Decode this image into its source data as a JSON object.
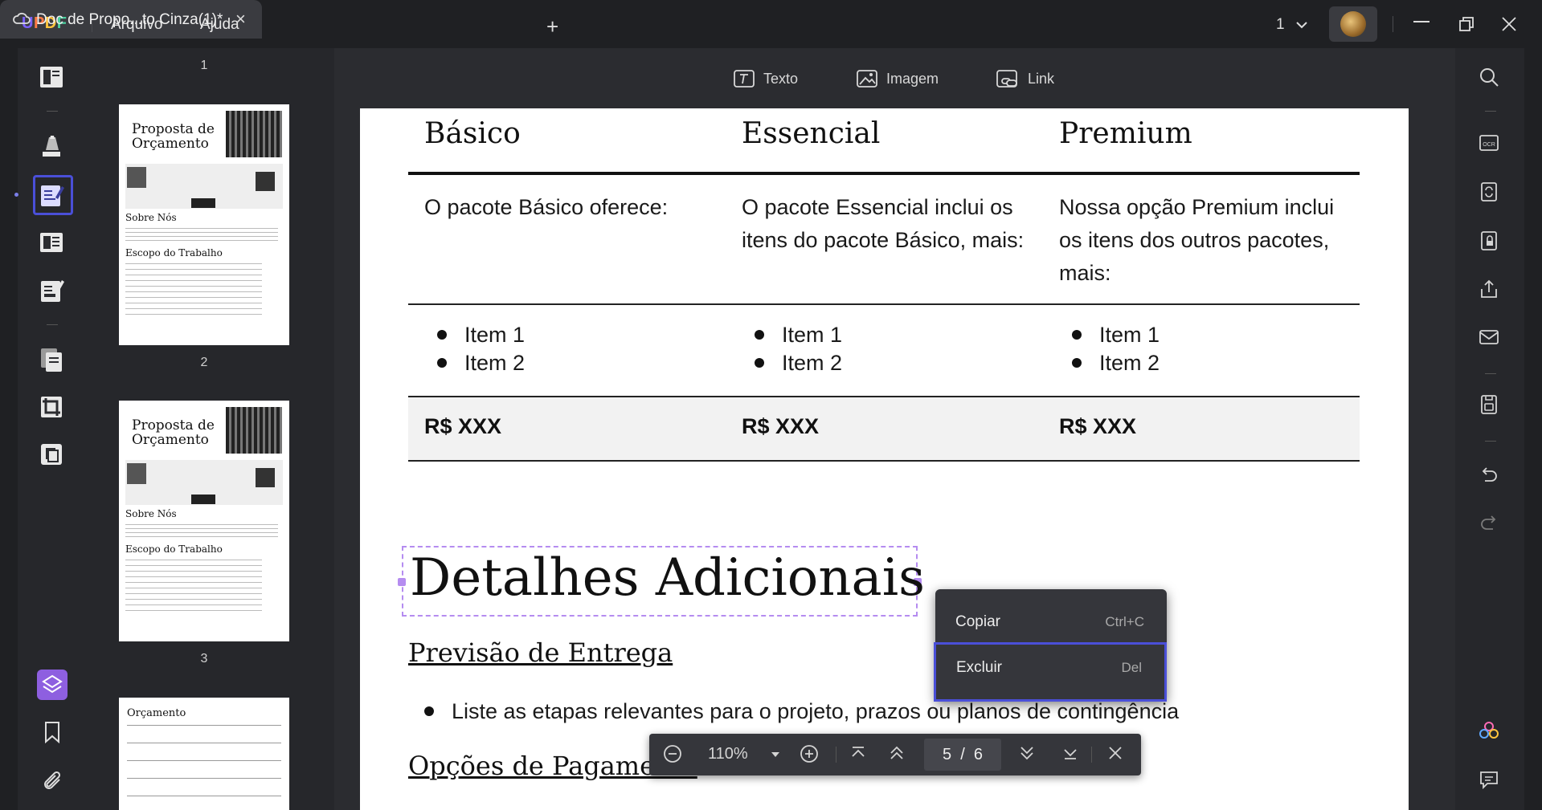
{
  "titlebar": {
    "logo": [
      "U",
      "P",
      "D",
      "F"
    ],
    "menu": [
      "Arquivo",
      "Ajuda"
    ],
    "tab_title": "Doc de Propo...to Cinza(1)*",
    "page_selector": "1"
  },
  "thumbnails": {
    "page_numbers": [
      "1",
      "2",
      "3"
    ],
    "thumb_title_line1": "Proposta de",
    "thumb_title_line2": "Orçamento",
    "thumb_sobre": "Sobre Nós",
    "thumb_escopo": "Escopo do Trabalho",
    "thumb_budget": "Orçamento"
  },
  "toolbar": {
    "texto": "Texto",
    "imagem": "Imagem",
    "link": "Link"
  },
  "document": {
    "headers": [
      "Básico",
      "Essencial",
      "Premium"
    ],
    "descriptions": [
      "O pacote Básico oferece:",
      "O pacote Essencial inclui os itens do pacote Básico, mais:",
      "Nossa opção Premium inclui os itens dos outros pacotes, mais:"
    ],
    "item1": "Item 1",
    "item2": "Item 2",
    "price": "R$ XXX",
    "heading": "Detalhes Adicionais",
    "subheading1": "Previsão de Entrega",
    "bullet": "Liste as etapas relevantes para o projeto, prazos ou planos de contingência",
    "subheading2": "Opções de Pagamento"
  },
  "context_menu": {
    "copy_label": "Copiar",
    "copy_shortcut": "Ctrl+C",
    "delete_label": "Excluir",
    "delete_shortcut": "Del"
  },
  "zoom_bar": {
    "zoom": "110%",
    "current_page": "5",
    "separator": "/",
    "total_pages": "6"
  },
  "colors": {
    "accent": "#4a4fd8",
    "selection": "#b58cf0",
    "background": "#1f2023"
  }
}
